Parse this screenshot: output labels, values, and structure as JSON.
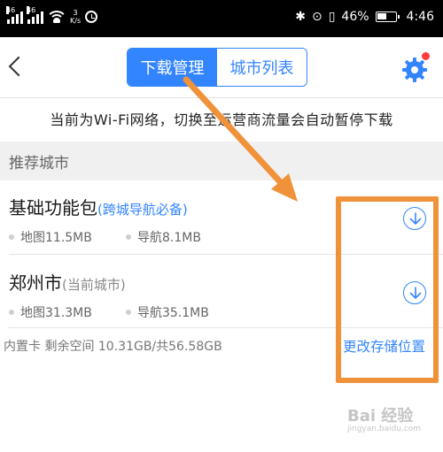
{
  "status_bar": {
    "sim1": "46",
    "sim2": "46",
    "speed_value": "3",
    "speed_unit": "K/s",
    "battery_percent": "46%",
    "time": "4:46"
  },
  "nav": {
    "tabs": [
      {
        "label": "下载管理",
        "active": true
      },
      {
        "label": "城市列表",
        "active": false
      }
    ],
    "settings_icon": "gear-icon",
    "notification_color": "#ff3b3b"
  },
  "notice": "当前为Wi-Fi网络，切换至运营商流量会自动暂停下载",
  "section_header": "推荐城市",
  "cities": [
    {
      "name": "基础功能包",
      "note": "(跨城导航必备)",
      "map_size": "地图11.5MB",
      "nav_size": "导航8.1MB"
    },
    {
      "name": "郑州市",
      "note": "(当前城市)",
      "map_size": "地图31.3MB",
      "nav_size": "导航35.1MB"
    }
  ],
  "storage": {
    "info": "内置卡 剩余空间 10.31GB/共56.58GB",
    "change_label": "更改存储位置"
  },
  "watermark": {
    "main": "Bai 经验",
    "sub": "jingyan.baidu.com"
  },
  "colors": {
    "accent": "#3385ff",
    "annotation": "#f0923a"
  }
}
